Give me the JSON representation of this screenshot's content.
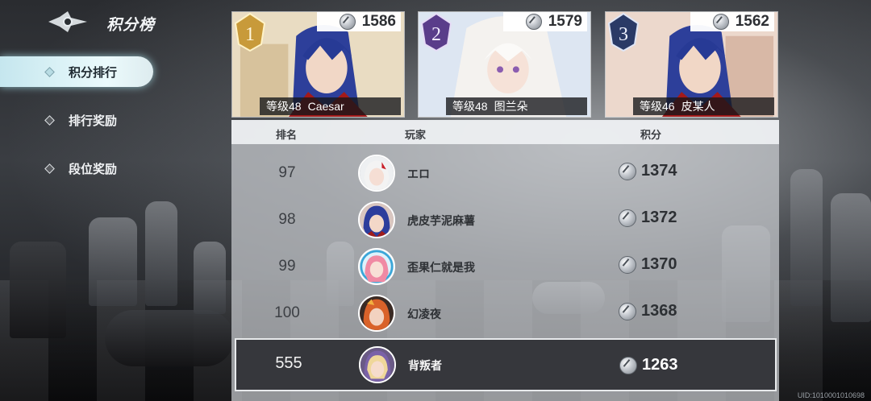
{
  "sidebar": {
    "title": "积分榜",
    "items": [
      {
        "label": "积分排行",
        "active": true
      },
      {
        "label": "排行奖励",
        "active": false
      },
      {
        "label": "段位奖励",
        "active": false
      }
    ]
  },
  "podium": [
    {
      "rank": "1",
      "score": "1586",
      "level": "等级48",
      "name": "Caesar"
    },
    {
      "rank": "2",
      "score": "1579",
      "level": "等级48",
      "name": "图兰朵"
    },
    {
      "rank": "3",
      "score": "1562",
      "level": "等级46",
      "name": "皮某人"
    }
  ],
  "table": {
    "headers": {
      "rank": "排名",
      "player": "玩家",
      "score": "积分"
    },
    "rows": [
      {
        "rank": "97",
        "name": "エロ",
        "score": "1374"
      },
      {
        "rank": "98",
        "name": "虎皮芋泥麻薯",
        "score": "1372"
      },
      {
        "rank": "99",
        "name": "歪果仁就是我",
        "score": "1370"
      },
      {
        "rank": "100",
        "name": "幻凌夜",
        "score": "1368"
      }
    ]
  },
  "self": {
    "rank": "555",
    "name": "背叛者",
    "score": "1263"
  },
  "uid": "UID:1010001010698",
  "colors": {
    "accent": "#d6f2f8",
    "gold": "#c89a3a",
    "purple": "#5a3d8a",
    "navy": "#2a3a66"
  }
}
